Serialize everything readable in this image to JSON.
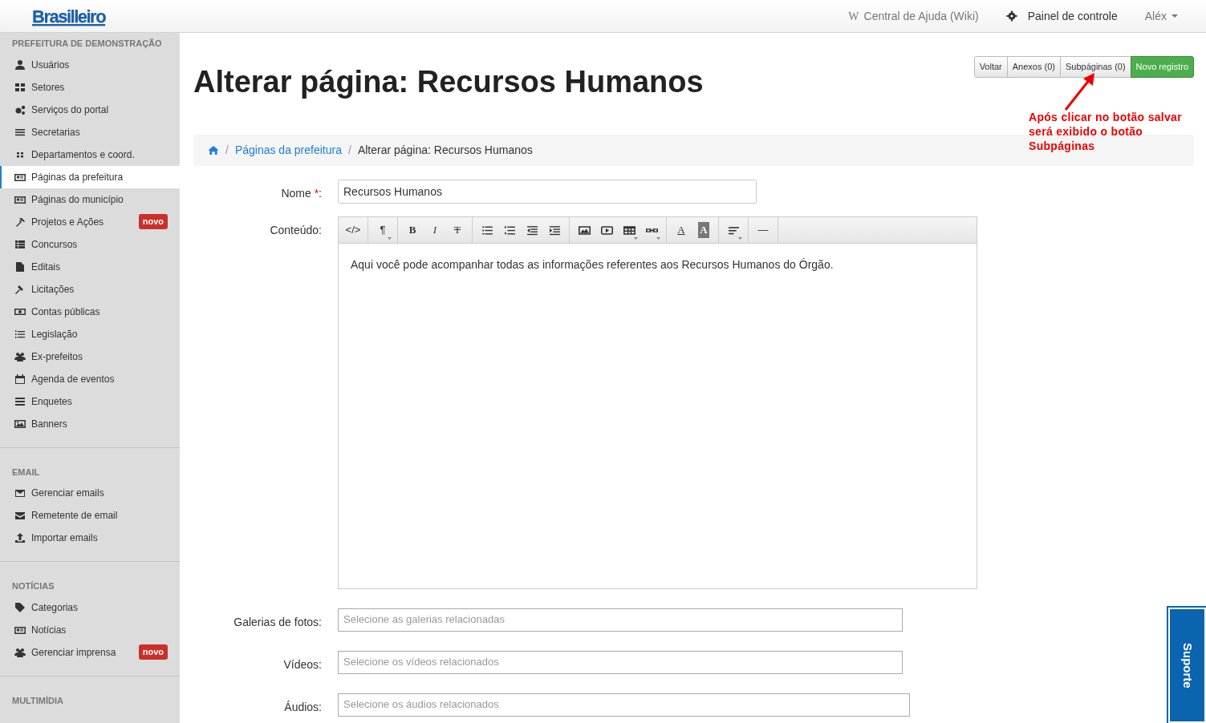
{
  "navbar": {
    "brand": "Brasilleiro",
    "links": [
      {
        "kind": "wiki",
        "glyph": "W",
        "label": "Central de Ajuda (Wiki)"
      },
      {
        "kind": "gear",
        "label": "Painel de controle"
      },
      {
        "kind": "user",
        "label": "Aléx",
        "caret": true
      }
    ]
  },
  "sidebar": {
    "sections": [
      {
        "title": "PREFEITURA DE DEMONSTRAÇÃO",
        "items": [
          {
            "kind": "user",
            "label": "Usuários",
            "selected": false
          },
          {
            "kind": "grid",
            "label": "Setores",
            "selected": false
          },
          {
            "kind": "cogs",
            "label": "Serviços do portal",
            "selected": false
          },
          {
            "kind": "bars",
            "label": "Secretarias",
            "selected": false
          },
          {
            "kind": "dots",
            "label": "Departamentos e coord.",
            "selected": false
          },
          {
            "kind": "news",
            "label": "Páginas da prefeitura",
            "selected": true
          },
          {
            "kind": "news",
            "label": "Páginas do município",
            "selected": false
          },
          {
            "kind": "tools",
            "label": "Projetos e Ações",
            "selected": false,
            "badge": "novo"
          },
          {
            "kind": "table",
            "label": "Concursos",
            "selected": false
          },
          {
            "kind": "file",
            "label": "Editais",
            "selected": false
          },
          {
            "kind": "gavel",
            "label": "Licitações",
            "selected": false
          },
          {
            "kind": "money",
            "label": "Contas públicas",
            "selected": false
          },
          {
            "kind": "olist",
            "label": "Legislação",
            "selected": false
          },
          {
            "kind": "users",
            "label": "Ex-prefeitos",
            "selected": false
          },
          {
            "kind": "calendar",
            "label": "Agenda de eventos",
            "selected": false
          },
          {
            "kind": "tasks",
            "label": "Enquetes",
            "selected": false
          },
          {
            "kind": "image",
            "label": "Banners",
            "selected": false
          }
        ]
      },
      {
        "title": "EMAIL",
        "items": [
          {
            "kind": "envelope-o",
            "label": "Gerenciar emails",
            "selected": false
          },
          {
            "kind": "envelope",
            "label": "Remetente de email",
            "selected": false
          },
          {
            "kind": "upload",
            "label": "Importar emails",
            "selected": false
          }
        ]
      },
      {
        "title": "NOTÍCIAS",
        "items": [
          {
            "kind": "tag",
            "label": "Categorias",
            "selected": false
          },
          {
            "kind": "news",
            "label": "Notícias",
            "selected": false
          },
          {
            "kind": "users",
            "label": "Gerenciar imprensa",
            "selected": false,
            "badge": "novo"
          }
        ]
      },
      {
        "title": "MULTIMÍDIA"
      }
    ]
  },
  "page": {
    "title": "Alterar página: Recursos Humanos",
    "actions": [
      {
        "label": "Voltar",
        "kind": "default"
      },
      {
        "label": "Anexos (0)",
        "kind": "default"
      },
      {
        "label": "Subpáginas (0)",
        "kind": "default"
      },
      {
        "label": "Novo registro",
        "kind": "success"
      }
    ],
    "annotation": "Após clicar no botão salvar será exibido o botão Subpáginas",
    "breadcrumb": [
      {
        "kind": "home"
      },
      {
        "separator": "/",
        "label": "Páginas da prefeitura",
        "kind": "link"
      },
      {
        "separator": "/",
        "label": "Alterar página: Recursos Humanos",
        "kind": "current"
      }
    ],
    "form": {
      "name_label": "Nome",
      "required_mark": "*",
      "colon": ":",
      "name_value": "Recursos Humanos",
      "content_label": "Conteúdo:",
      "toolbar": [
        [
          {
            "kind": "text",
            "glyph": "</>"
          }
        ],
        [
          {
            "kind": "text",
            "glyph": "¶",
            "caret": true
          }
        ],
        [
          {
            "kind": "bold",
            "glyph": "B"
          },
          {
            "kind": "italic",
            "glyph": "I"
          },
          {
            "kind": "strike",
            "glyph": "T"
          }
        ],
        [
          {
            "kind": "ul"
          },
          {
            "kind": "ol"
          },
          {
            "kind": "outdent"
          },
          {
            "kind": "indent"
          }
        ],
        [
          {
            "kind": "image"
          },
          {
            "kind": "video"
          },
          {
            "kind": "table",
            "caret": true
          },
          {
            "kind": "link",
            "caret": true
          }
        ],
        [
          {
            "kind": "color",
            "glyph": "A"
          },
          {
            "kind": "bgcolor",
            "glyph": "A"
          }
        ],
        [
          {
            "kind": "align",
            "caret": true
          }
        ],
        [
          {
            "kind": "text",
            "glyph": "—"
          }
        ]
      ],
      "content": "Aqui você pode acompanhar todas as informações referentes aos Recursos Humanos do Órgão.",
      "selects": [
        {
          "label": "Galerias de fotos:",
          "placeholder": "Selecione as galerias relacionadas"
        },
        {
          "label": "Vídeos:",
          "placeholder": "Selecione os vídeos relacionados"
        },
        {
          "label": "Áudios:",
          "placeholder": "Selecione os áudios relacionados"
        }
      ]
    }
  },
  "support": {
    "label": "Suporte"
  }
}
